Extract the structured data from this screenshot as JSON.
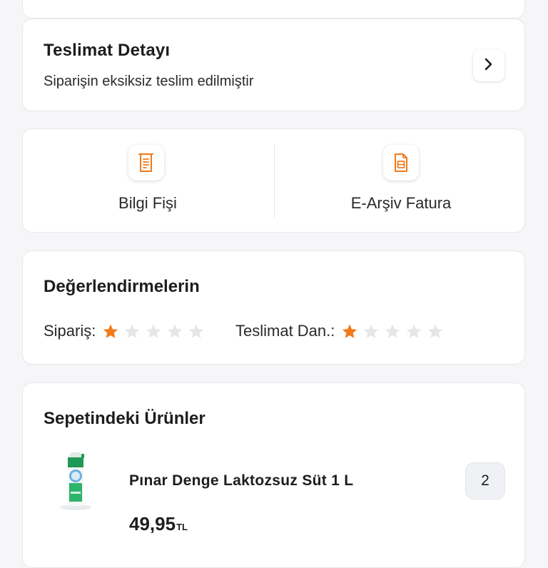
{
  "delivery": {
    "title": "Teslimat Detayı",
    "subtitle": "Siparişin eksiksiz teslim edilmiştir"
  },
  "documents": {
    "items": [
      {
        "label": "Bilgi Fişi",
        "icon": "receipt-icon"
      },
      {
        "label": "E-Arşiv Fatura",
        "icon": "invoice-icon"
      }
    ]
  },
  "ratings": {
    "title": "Değerlendirmelerin",
    "order_label": "Sipariş:",
    "order_stars": 1,
    "delivery_label": "Teslimat Dan.:",
    "delivery_stars": 1,
    "max_stars": 5
  },
  "products": {
    "title": "Sepetindeki Ürünler",
    "items": [
      {
        "name": "Pınar Denge Laktozsuz Süt 1 L",
        "price": "49,95",
        "currency": "TL",
        "quantity": "2",
        "image": "milk-carton-image"
      }
    ]
  },
  "colors": {
    "accent": "#f27a1a",
    "star_empty": "#e6e6e9",
    "card_border": "#e7e7ec",
    "background": "#f6f6f8"
  }
}
